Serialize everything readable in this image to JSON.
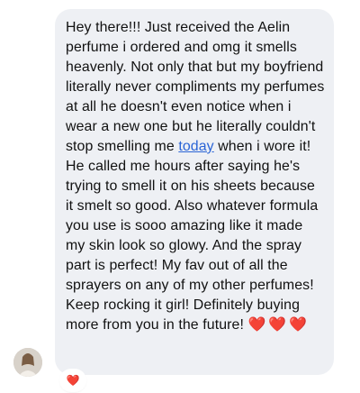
{
  "message": {
    "text_before_link": "Hey there!!! Just received the Aelin perfume i ordered and omg it smells heavenly. Not only that but my boyfriend literally never compliments my perfumes at all he doesn't even notice when i wear a new one but he literally couldn't stop smelling me ",
    "link_text": "today",
    "text_after_link": " when i wore it! He called me hours after saying he's trying to smell it on his sheets because it smelt so good. Also whatever formula you use is sooo amazing like it made my skin look so glowy. And the spray part is perfect! My fav out of all the sprayers on any of my other perfumes! Keep rocking it girl! Definitely buying more from you in the future! ",
    "emoji_hearts": "❤️❤️❤️"
  },
  "reaction": {
    "emoji": "❤️"
  },
  "colors": {
    "bubble_bg": "#eef0f4",
    "link": "#2a64d6",
    "text": "#111111"
  }
}
